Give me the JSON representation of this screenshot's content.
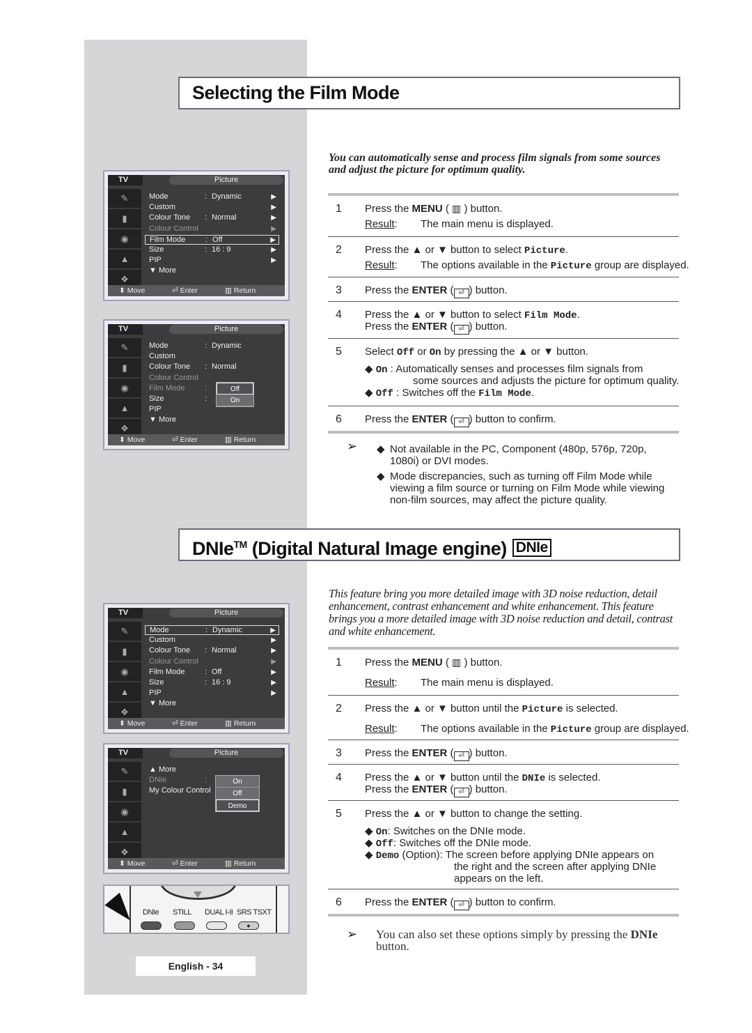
{
  "section1": {
    "title": "Selecting the Film Mode",
    "intro": "You can automatically sense and process film signals from some sources and adjust the picture for optimum quality.",
    "steps": [
      {
        "num": "1",
        "lines": [
          [
            {
              "t": "Press the "
            },
            {
              "t": "MENU",
              "s": "b"
            },
            {
              "t": " ( "
            },
            {
              "t": "menu-icon",
              "s": "icon"
            },
            {
              "t": " ) button."
            }
          ],
          [
            {
              "t": "Result",
              "s": "u"
            },
            {
              "t": ":",
              "tab": 1
            },
            {
              "t": "The main menu is displayed.",
              "col": 1
            }
          ]
        ]
      },
      {
        "num": "2",
        "lines": [
          [
            {
              "t": "Press the ▲ or ▼ button to select "
            },
            {
              "t": "Picture",
              "s": "m"
            },
            {
              "t": "."
            }
          ],
          [
            {
              "t": "Result",
              "s": "u"
            },
            {
              "t": ":"
            },
            {
              "t": "The options available in the ",
              "col": 1
            },
            {
              "t": "Picture",
              "s": "m"
            },
            {
              "t": " group are displayed."
            }
          ]
        ]
      },
      {
        "num": "3",
        "lines": [
          [
            {
              "t": "Press the "
            },
            {
              "t": "ENTER",
              "s": "b"
            },
            {
              "t": " ("
            },
            {
              "t": "enter-icon",
              "s": "enter"
            },
            {
              "t": ") button."
            }
          ]
        ]
      },
      {
        "num": "4",
        "lines": [
          [
            {
              "t": "Press the ▲ or ▼ button to select "
            },
            {
              "t": "Film Mode",
              "s": "m"
            },
            {
              "t": "."
            }
          ],
          [
            {
              "t": "Press the "
            },
            {
              "t": "ENTER",
              "s": "b"
            },
            {
              "t": " ("
            },
            {
              "t": "enter-icon",
              "s": "enter"
            },
            {
              "t": ") button."
            }
          ]
        ]
      },
      {
        "num": "5",
        "lines": [
          [
            {
              "t": "Select "
            },
            {
              "t": "Off",
              "s": "m"
            },
            {
              "t": " or "
            },
            {
              "t": "On",
              "s": "m"
            },
            {
              "t": " by pressing the ▲ or ▼ button."
            }
          ],
          [
            {
              "t": "◆  ",
              "ind": 1
            },
            {
              "t": "On",
              "s": "m"
            },
            {
              "t": "  :   Automatically senses and processes film signals from"
            }
          ],
          [
            {
              "t": "some sources and adjusts the picture for optimum quality.",
              "ind": 2
            }
          ],
          [
            {
              "t": "◆  ",
              "ind": 1
            },
            {
              "t": "Off",
              "s": "m"
            },
            {
              "t": " :  Switches off the "
            },
            {
              "t": "Film Mode",
              "s": "m"
            },
            {
              "t": "."
            }
          ]
        ]
      },
      {
        "num": "6",
        "lines": [
          [
            {
              "t": "Press the "
            },
            {
              "t": "ENTER",
              "s": "b"
            },
            {
              "t": " ("
            },
            {
              "t": "enter-icon",
              "s": "enter"
            },
            {
              "t": ") button to confirm."
            }
          ]
        ]
      }
    ],
    "notes": [
      "Not available in the PC, Component (480p, 576p, 720p, 1080i) or DVI modes.",
      "Mode discrepancies, such as turning off Film Mode while viewing a film source or turning on Film Mode while viewing non-film sources, may affect the picture quality."
    ]
  },
  "section2": {
    "title": "DNIe",
    "title_tm": "TM",
    "title_rest": " (Digital Natural Image engine)",
    "logo": "DNIe",
    "intro": "This feature bring you more detailed image with 3D noise reduction, detail enhancement, contrast enhancement and white enhancement. This feature brings you a more detailed image with 3D noise reduction and detail, contrast and white enhancement.",
    "steps": [
      {
        "num": "1",
        "lines": [
          [
            {
              "t": "Press the "
            },
            {
              "t": "MENU",
              "s": "b"
            },
            {
              "t": " ( "
            },
            {
              "t": "menu-icon",
              "s": "icon"
            },
            {
              "t": " ) button."
            }
          ],
          [
            {
              "t": "Result",
              "s": "u"
            },
            {
              "t": ":"
            },
            {
              "t": "The main menu is displayed.",
              "col": 1
            }
          ]
        ]
      },
      {
        "num": "2",
        "lines": [
          [
            {
              "t": "Press the ▲ or ▼ button until the "
            },
            {
              "t": "Picture",
              "s": "m"
            },
            {
              "t": " is selected."
            }
          ],
          [
            {
              "t": "Result",
              "s": "u"
            },
            {
              "t": ":"
            },
            {
              "t": "The options available in the ",
              "col": 1
            },
            {
              "t": "Picture",
              "s": "m"
            },
            {
              "t": " group are displayed."
            }
          ]
        ]
      },
      {
        "num": "3",
        "lines": [
          [
            {
              "t": "Press the "
            },
            {
              "t": "ENTER",
              "s": "b"
            },
            {
              "t": " ("
            },
            {
              "t": "enter-icon",
              "s": "enter"
            },
            {
              "t": ") button."
            }
          ]
        ]
      },
      {
        "num": "4",
        "lines": [
          [
            {
              "t": "Press the ▲ or ▼ button until the "
            },
            {
              "t": "DNIe",
              "s": "m"
            },
            {
              "t": " is selected."
            }
          ],
          [
            {
              "t": "Press the "
            },
            {
              "t": "ENTER",
              "s": "b"
            },
            {
              "t": " ("
            },
            {
              "t": "enter-icon",
              "s": "enter"
            },
            {
              "t": ") button."
            }
          ]
        ]
      },
      {
        "num": "5",
        "lines": [
          [
            {
              "t": "Press the ▲ or ▼ button to change the setting."
            }
          ],
          [
            {
              "t": "◆  ",
              "ind": 1
            },
            {
              "t": "On",
              "s": "m"
            },
            {
              "t": ": Switches on the DNIe mode."
            }
          ],
          [
            {
              "t": "◆  ",
              "ind": 1
            },
            {
              "t": "Off",
              "s": "m"
            },
            {
              "t": ": Switches off the DNIe mode."
            }
          ],
          [
            {
              "t": "◆  ",
              "ind": 1
            },
            {
              "t": "Demo",
              "s": "m"
            },
            {
              "t": " (Option): The screen before applying DNIe appears on"
            }
          ],
          [
            {
              "t": "the  right and the screen after applying DNIe",
              "ind": 3
            }
          ],
          [
            {
              "t": "appears on the left.",
              "ind": 3
            }
          ]
        ]
      },
      {
        "num": "6",
        "lines": [
          [
            {
              "t": "Press the "
            },
            {
              "t": "ENTER",
              "s": "b"
            },
            {
              "t": " ("
            },
            {
              "t": "enter-icon",
              "s": "enter"
            },
            {
              "t": ") button to confirm."
            }
          ]
        ]
      }
    ],
    "note_prefix": "You can also set these options simply by pressing the",
    "note_bold": "DNIe",
    "note_suffix": " button."
  },
  "menu_common": {
    "tv": "TV",
    "header": "Picture",
    "move": "Move",
    "enter": "Enter",
    "return": "Return",
    "icons": [
      "antenna-icon",
      "picture-icon",
      "sound-icon",
      "channel-icon",
      "setup-icon"
    ]
  },
  "menus": [
    {
      "items": [
        {
          "l": "Mode",
          "v": "Dynamic",
          "a": 1
        },
        {
          "l": "Custom",
          "a": 1
        },
        {
          "l": "Colour Tone",
          "v": "Normal",
          "a": 1
        },
        {
          "l": "Colour Control",
          "a": 1,
          "dim": 1
        },
        {
          "l": "Film Mode",
          "v": "Off",
          "a": 1,
          "sel": 1
        },
        {
          "l": "Size",
          "v": "16 : 9",
          "a": 1
        },
        {
          "l": "PIP",
          "a": 1
        },
        {
          "l": "▼ More"
        }
      ]
    },
    {
      "items": [
        {
          "l": "Mode",
          "v": "Dynamic"
        },
        {
          "l": "Custom"
        },
        {
          "l": "Colour Tone",
          "v": "Normal"
        },
        {
          "l": "Colour Control",
          "dim": 1
        },
        {
          "l": "Film Mode",
          "v": "",
          "dim": 1
        },
        {
          "l": "Size",
          "v": ""
        },
        {
          "l": "PIP"
        },
        {
          "l": "▼ More"
        }
      ],
      "popup": [
        "Off",
        "On"
      ],
      "popup_sel": 0
    },
    {
      "items": [
        {
          "l": "Mode",
          "v": "Dynamic",
          "a": 1,
          "sel": 1
        },
        {
          "l": "Custom",
          "a": 1
        },
        {
          "l": "Colour Tone",
          "v": "Normal",
          "a": 1
        },
        {
          "l": "Colour Control",
          "a": 1,
          "dim": 1
        },
        {
          "l": "Film Mode",
          "v": "Off",
          "a": 1
        },
        {
          "l": "Size",
          "v": "16 : 9",
          "a": 1
        },
        {
          "l": "PIP",
          "a": 1
        },
        {
          "l": "▼ More"
        }
      ]
    },
    {
      "items": [
        {
          "l": "▲ More"
        },
        {
          "l": "DNIe",
          "v": "",
          "dim": 1
        },
        {
          "l": "My Colour Control"
        }
      ],
      "popup": [
        "On",
        "Off",
        "Demo"
      ],
      "popup_sel": 2
    }
  ],
  "remote": {
    "buttons": [
      {
        "label": "DNIe",
        "color": "#555555"
      },
      {
        "label": "STILL",
        "color": "#999999"
      },
      {
        "label": "DUAL I-II",
        "color": "#e6e6e6"
      },
      {
        "label": "SRS TSXT",
        "color": "#cccccc"
      }
    ]
  },
  "footer": "English - 34"
}
